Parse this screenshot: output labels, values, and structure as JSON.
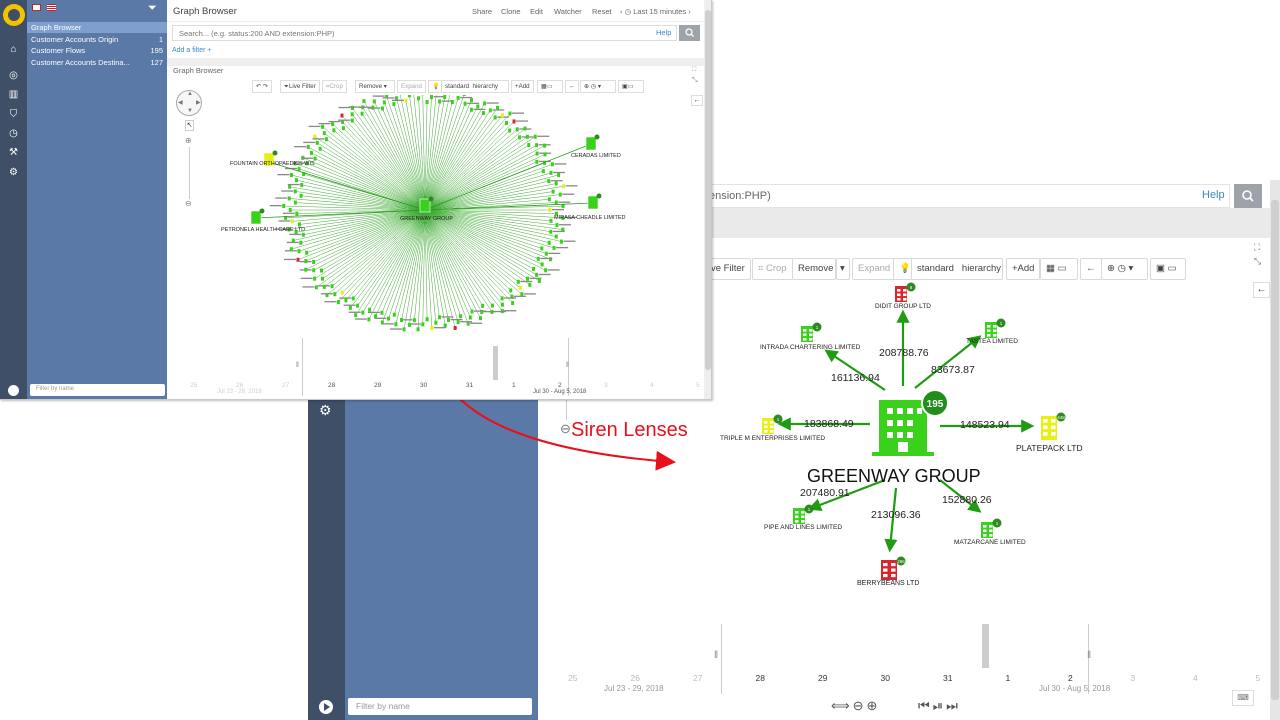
{
  "app": {
    "title": "Graph Browser",
    "top_links": [
      "Share",
      "Clone",
      "Edit",
      "Watcher",
      "Reset"
    ],
    "time_range": "Last 15 minutes",
    "search_placeholder": "Search... (e.g. status:200 AND extension:PHP)",
    "search_placeholder_zoom": "ension:PHP)",
    "help": "Help",
    "add_filter": "Add a filter",
    "visualization_title": "Graph Browser",
    "filter_placeholder": "Filter by name"
  },
  "saved_searches": [
    {
      "label": "Graph Browser",
      "count": "",
      "selected": true
    },
    {
      "label": "Customer Accounts Origin",
      "count": "1",
      "selected": false
    },
    {
      "label": "Customer Flows",
      "count": "195",
      "selected": false
    },
    {
      "label": "Customer Accounts Destina...",
      "count": "127",
      "selected": false
    }
  ],
  "toolbar": {
    "live_filter": "Live Filter",
    "live_filter_zoom": "ve Filter",
    "crop": "Crop",
    "remove": "Remove",
    "expand": "Expand",
    "standard": "standard",
    "hierarchy": "hierarchy",
    "add": "+Add"
  },
  "graph": {
    "center": {
      "label": "GREENWAY GROUP",
      "badge": "195"
    },
    "nodes": [
      {
        "label": "DIDIT GROUP LTD",
        "badge": "8",
        "color": "#d9262c",
        "edge": "208788.76"
      },
      {
        "label": "TASTEA LIMITED",
        "badge": "1",
        "color": "#39d11b",
        "edge": "83673.87"
      },
      {
        "label": "INTRADA CHARTERING LIMITED",
        "badge": "1",
        "color": "#39d11b",
        "edge": "161136.94"
      },
      {
        "label": "TRIPLE M ENTERPRISES LIMITED",
        "badge": "1",
        "color": "#e8f013",
        "edge": "183868.49"
      },
      {
        "label": "PLATEPACK LTD",
        "badge": "448",
        "color": "#e8f013",
        "edge": "148523.94"
      },
      {
        "label": "PIPE AND LINES LIMITED",
        "badge": "1",
        "color": "#39d11b",
        "edge": "207480.91"
      },
      {
        "label": "MATZARCANE LIMITED",
        "badge": "1",
        "color": "#39d11b",
        "edge": "152880.26"
      },
      {
        "label": "BERRYBEANS LTD",
        "badge": "266",
        "color": "#d9262c",
        "edge": "213096.36"
      }
    ],
    "mini_labels": [
      "FOUNTAIN ORTHOPAEDICS WIS",
      "CERADAS LIMITED",
      "GREENWAY GROUP",
      "MIRASA CHEADLE LIMITED",
      "PETRONELA HEALTH CARE LTD"
    ]
  },
  "timeline": {
    "ticks_zoom": [
      "25",
      "26",
      "27",
      "28",
      "29",
      "30",
      "31",
      "1",
      "2",
      "3",
      "4",
      "5"
    ],
    "ticks_mini": [
      "25",
      "26",
      "27",
      "28",
      "29",
      "30",
      "31",
      "1",
      "2",
      "3",
      "4",
      "5"
    ],
    "range_left": "Jul 23 - 29, 2018",
    "range_right": "Jul 30 - Aug 5, 2018"
  },
  "annotation": "Siren Lenses",
  "colors": {
    "rail": "#3f4f67",
    "panel": "#5b79a6",
    "node_green": "#39d11b",
    "edge": "#1f9c12",
    "arrow": "#e8101e"
  }
}
